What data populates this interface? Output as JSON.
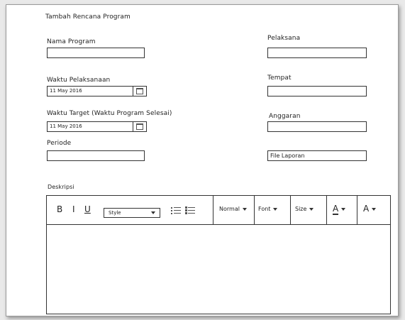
{
  "form": {
    "title": "Tambah Rencana Program",
    "nama_program": {
      "label": "Nama Program",
      "value": ""
    },
    "pelaksana": {
      "label": "Pelaksana",
      "value": ""
    },
    "waktu_pelaksanaan": {
      "label": "Waktu Pelaksanaan",
      "value": "11 May 2016"
    },
    "tempat": {
      "label": "Tempat",
      "value": ""
    },
    "waktu_target": {
      "label": "Waktu Target (Waktu Program Selesai)",
      "value": "11 May 2016"
    },
    "anggaran": {
      "label": "Anggaran",
      "value": ""
    },
    "periode": {
      "label": "Periode",
      "value": ""
    },
    "file_laporan": {
      "value": "File Laporan"
    },
    "deskripsi": {
      "label": "Deskripsi"
    }
  },
  "editor": {
    "bold": "B",
    "italic": "I",
    "underline": "U",
    "style_select": "Style",
    "paragraph_select": "Normal",
    "font_select": "Font",
    "size_select": "Size",
    "font_color": "A",
    "bg_color": "A",
    "icons": {
      "bullet_list": "bullet-list-icon",
      "numbered_list": "numbered-list-icon",
      "calendar": "calendar-icon"
    }
  }
}
